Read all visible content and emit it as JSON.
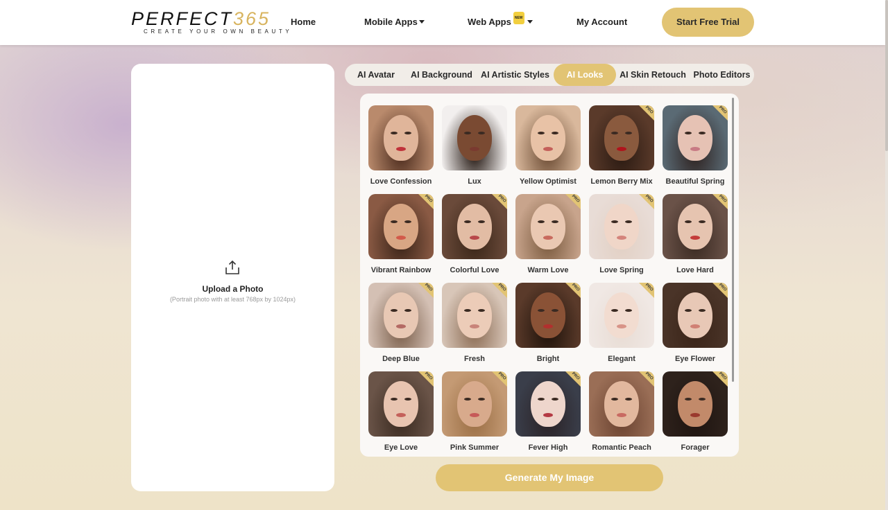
{
  "header": {
    "logo_main_black": "PERFECT",
    "logo_main_gold": "365",
    "logo_tagline": "CREATE YOUR OWN BEAUTY",
    "nav": [
      {
        "label": "Home",
        "has_caret": false
      },
      {
        "label": "Mobile Apps",
        "has_caret": true
      },
      {
        "label": "Web Apps",
        "has_caret": true,
        "badge": "NEW"
      },
      {
        "label": "My Account",
        "has_caret": false
      }
    ],
    "cta_label": "Start Free Trial"
  },
  "upload": {
    "icon": "upload-icon",
    "title": "Upload a Photo",
    "hint": "(Portrait photo with at least 768px by 1024px)"
  },
  "tabs": {
    "items": [
      "AI Avatar",
      "AI Background",
      "AI Artistic Styles",
      "AI Looks",
      "AI Skin Retouch",
      "Photo Editors"
    ],
    "active": "AI Looks"
  },
  "looks": {
    "pro_label": "PRO",
    "items": [
      {
        "label": "Love Confession",
        "pro": false,
        "skin": "#e0b59a",
        "hair": "#4a2a1c",
        "lips": "#c0323a",
        "bg": "#b98a6c"
      },
      {
        "label": "Lux",
        "pro": false,
        "skin": "#7a4a32",
        "hair": "#1e120c",
        "lips": "#7a3a30",
        "bg": "#f2efee"
      },
      {
        "label": "Yellow Optimist",
        "pro": false,
        "skin": "#e8c2a6",
        "hair": "#6a4a32",
        "lips": "#c4605a",
        "bg": "#d9b89c"
      },
      {
        "label": "Lemon Berry Mix",
        "pro": true,
        "skin": "#8a5a3e",
        "hair": "#2a1a12",
        "lips": "#b0141c",
        "bg": "#5a3a2a"
      },
      {
        "label": "Beautiful Spring",
        "pro": true,
        "skin": "#e6c2b4",
        "hair": "#2e2220",
        "lips": "#c87a84",
        "bg": "#5a6a74"
      },
      {
        "label": "Vibrant Rainbow",
        "pro": true,
        "skin": "#d8a684",
        "hair": "#3a2418",
        "lips": "#d25a4a",
        "bg": "#8a5a44"
      },
      {
        "label": "Colorful Love",
        "pro": true,
        "skin": "#e2bca4",
        "hair": "#3a2618",
        "lips": "#b8484a",
        "bg": "#6a4a3a"
      },
      {
        "label": "Warm Love",
        "pro": true,
        "skin": "#eac8b2",
        "hair": "#7a5a3e",
        "lips": "#c86a5e",
        "bg": "#c8a48c"
      },
      {
        "label": "Love Spring",
        "pro": true,
        "skin": "#f0d6c8",
        "hair": "#e2d0c4",
        "lips": "#d4847c",
        "bg": "#e8dcd6"
      },
      {
        "label": "Love Hard",
        "pro": true,
        "skin": "#e6c4b0",
        "hair": "#3a2a22",
        "lips": "#c43c3a",
        "bg": "#6a5248"
      },
      {
        "label": "Deep Blue",
        "pro": true,
        "skin": "#e8c8b4",
        "hair": "#7a5e4a",
        "lips": "#b46a64",
        "bg": "#d4c0b4"
      },
      {
        "label": "Fresh",
        "pro": true,
        "skin": "#ecccb8",
        "hair": "#8a6a52",
        "lips": "#c8847a",
        "bg": "#d8c6b8"
      },
      {
        "label": "Bright",
        "pro": true,
        "skin": "#8a5236",
        "hair": "#1e120a",
        "lips": "#b2302e",
        "bg": "#5a3a2a"
      },
      {
        "label": "Elegant",
        "pro": true,
        "skin": "#f2dcd0",
        "hair": "#e8dcd4",
        "lips": "#d89488",
        "bg": "#f0e8e4"
      },
      {
        "label": "Eye Flower",
        "pro": true,
        "skin": "#e8c8b6",
        "hair": "#3a2418",
        "lips": "#d08074",
        "bg": "#4a3428"
      },
      {
        "label": "Eye Love",
        "pro": true,
        "skin": "#e8c4b0",
        "hair": "#3a2a20",
        "lips": "#c4605a",
        "bg": "#6a5448"
      },
      {
        "label": "Pink Summer",
        "pro": true,
        "skin": "#d8aa8c",
        "hair": "#9a6e44",
        "lips": "#c65a58",
        "bg": "#c49a74"
      },
      {
        "label": "Fever High",
        "pro": true,
        "skin": "#eed6cc",
        "hair": "#2a2226",
        "lips": "#b43a44",
        "bg": "#3a3e4a"
      },
      {
        "label": "Romantic Peach",
        "pro": true,
        "skin": "#e2b89e",
        "hair": "#6a4230",
        "lips": "#c86a62",
        "bg": "#9a6e56"
      },
      {
        "label": "Forager",
        "pro": true,
        "skin": "#c28a6a",
        "hair": "#1e1410",
        "lips": "#9a3a2e",
        "bg": "#2e221c"
      }
    ]
  },
  "generate_label": "Generate My Image"
}
